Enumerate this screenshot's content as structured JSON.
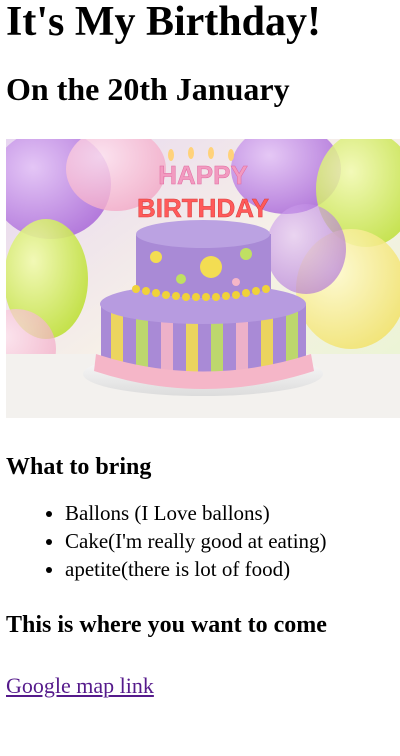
{
  "page": {
    "title": "It's My Birthday!",
    "date_heading": "On the 20th January",
    "bring_heading": "What to bring",
    "bring_items": [
      "Ballons (I Love ballons)",
      "Cake(I'm really good at eating)",
      "apetite(there is lot of food)"
    ],
    "location_heading": "This is where you want to come",
    "map_link": "Google map link"
  },
  "hero_image": {
    "topper_text": "HAPPY BIRTHDAY",
    "topper_line1": "HAPPY",
    "topper_line2": "BIRTHDAY"
  },
  "colors": {
    "link_visited": "#551a8b",
    "cake_purple": "#a98ad6",
    "cake_pink": "#f5b6c8",
    "cake_yellow": "#f3dd52",
    "balloon_green": "#d4ec5c"
  }
}
